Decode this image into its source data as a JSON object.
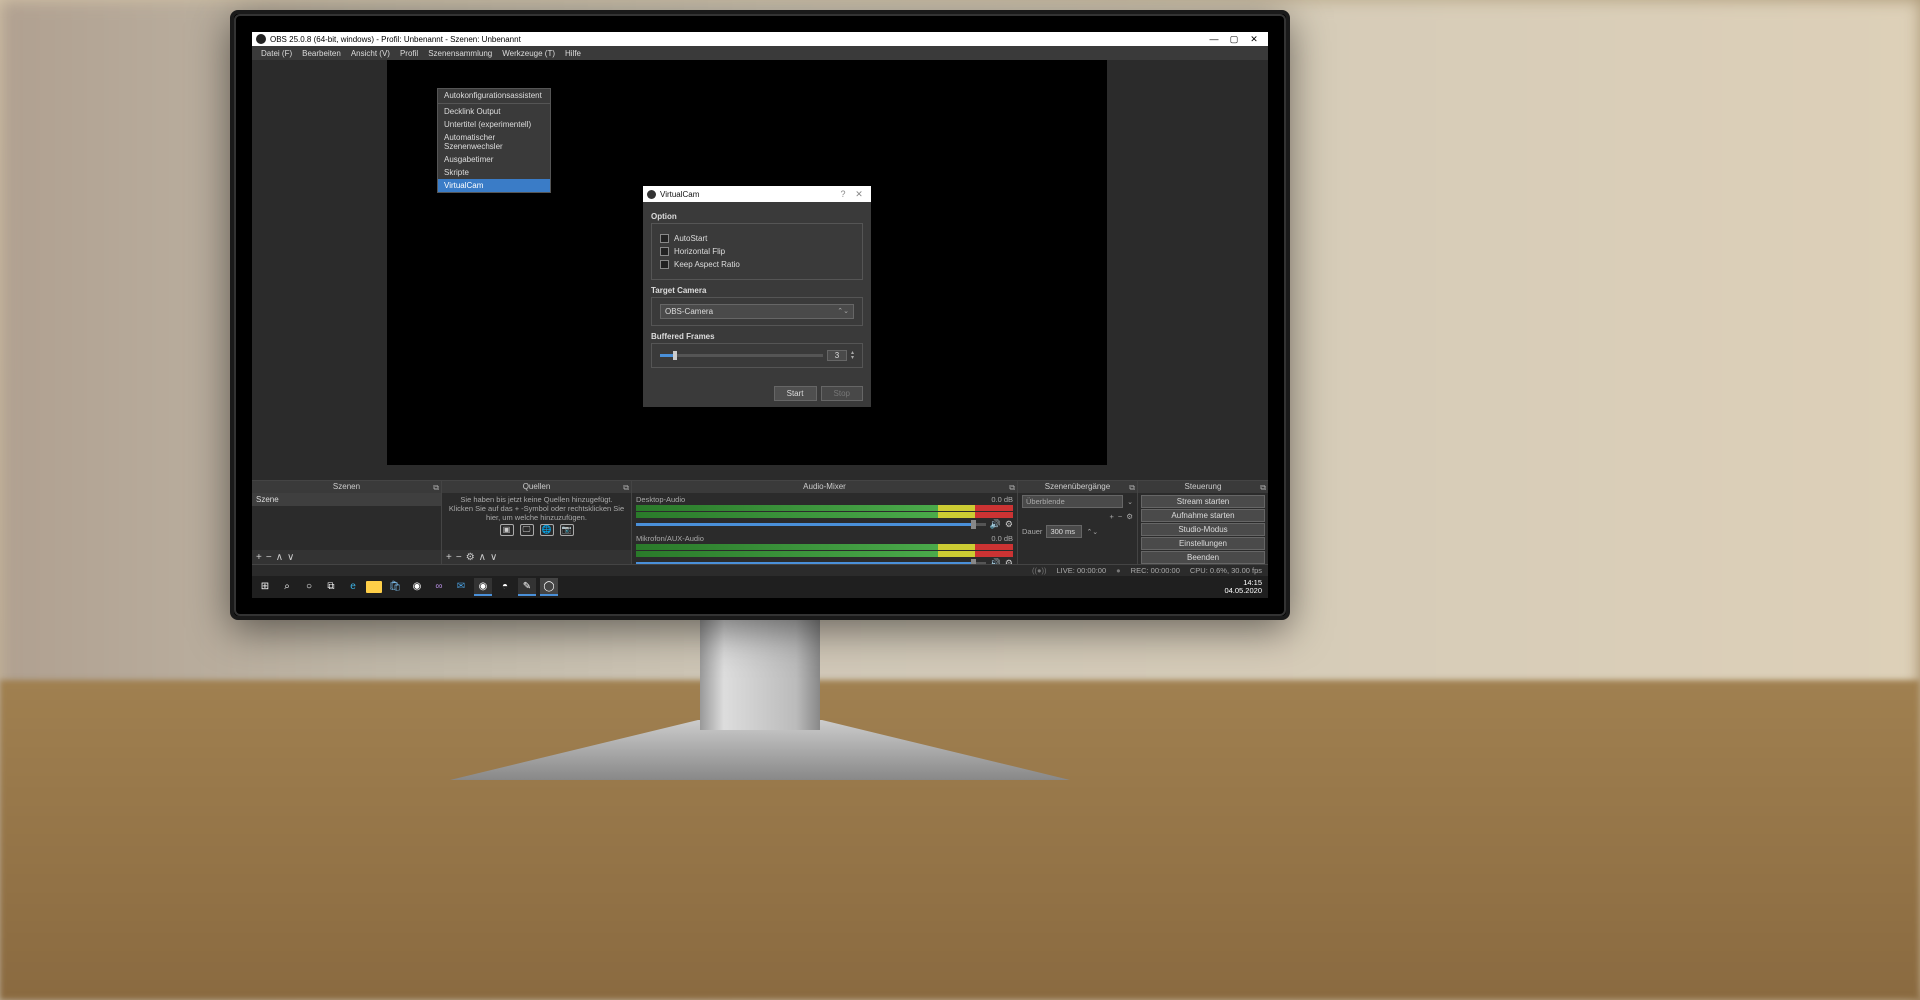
{
  "titlebar": {
    "title": "OBS 25.0.8 (64-bit, windows) - Profil: Unbenannt - Szenen: Unbenannt",
    "min": "—",
    "max": "▢",
    "close": "✕"
  },
  "menubar": [
    "Datei (F)",
    "Bearbeiten",
    "Ansicht (V)",
    "Profil",
    "Szenensammlung",
    "Werkzeuge (T)",
    "Hilfe"
  ],
  "dropdown": {
    "items": [
      "Autokonfigurationsassistent",
      "Decklink Output",
      "Untertitel (experimentell)",
      "Automatischer Szenenwechsler",
      "Ausgabetimer",
      "Skripte",
      "VirtualCam"
    ],
    "highlighted": "VirtualCam"
  },
  "dialog": {
    "title": "VirtualCam",
    "help": "?",
    "close": "✕",
    "option_label": "Option",
    "checks": [
      "AutoStart",
      "Horizontal Flip",
      "Keep Aspect Ratio"
    ],
    "target_label": "Target Camera",
    "target_value": "OBS-Camera",
    "buffered_label": "Buffered Frames",
    "buffered_value": "3",
    "start": "Start",
    "stop": "Stop"
  },
  "panels": {
    "scenes": {
      "title": "Szenen",
      "item": "Szene"
    },
    "sources": {
      "title": "Quellen",
      "empty1": "Sie haben bis jetzt keine Quellen hinzugefügt.",
      "empty2": "Klicken Sie auf das + -Symbol oder rechtsklicken Sie hier, um welche hinzuzufügen."
    },
    "mixer": {
      "title": "Audio-Mixer",
      "ch1": {
        "name": "Desktop-Audio",
        "level": "0.0 dB"
      },
      "ch2": {
        "name": "Mikrofon/AUX-Audio",
        "level": "0.0 dB"
      }
    },
    "transitions": {
      "title": "Szenenübergänge",
      "mode": "Überblende",
      "dur_label": "Dauer",
      "dur_value": "300 ms"
    },
    "controls": {
      "title": "Steuerung",
      "buttons": [
        "Stream starten",
        "Aufnahme starten",
        "Studio-Modus",
        "Einstellungen",
        "Beenden"
      ]
    }
  },
  "toolbar_icons": {
    "plus": "+",
    "minus": "−",
    "up": "∧",
    "down": "∨",
    "gear": "⚙"
  },
  "statusbar": {
    "live": "LIVE: 00:00:00",
    "rec": "REC: 00:00:00",
    "cpu": "CPU: 0.6%, 30.00 fps"
  },
  "taskbar": {
    "time": "14:15",
    "date": "04.05.2020"
  }
}
